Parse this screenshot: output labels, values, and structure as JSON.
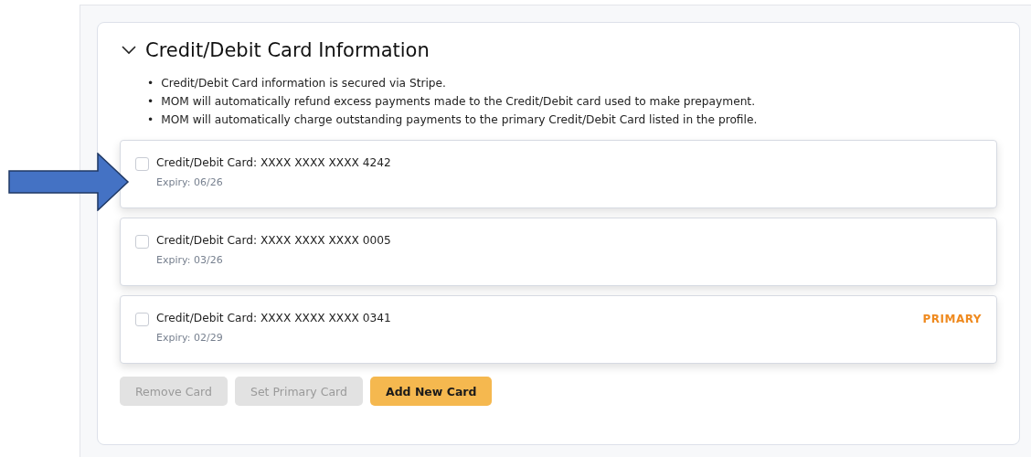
{
  "section": {
    "title": "Credit/Debit Card Information",
    "expanded": true
  },
  "notes": [
    {
      "bullet": "•",
      "text": "Credit/Debit Card information is secured via Stripe."
    },
    {
      "bullet": "•",
      "text": "MOM will automatically refund excess payments made to the Credit/Debit card used to make prepayment."
    },
    {
      "bullet": "•",
      "text": "MOM will automatically charge outstanding payments to the primary Credit/Debit Card listed in the profile."
    }
  ],
  "annotation": {
    "kind": "arrow"
  },
  "cards": [
    {
      "label": "Credit/Debit Card: XXXX XXXX XXXX 4242",
      "expiry": "Expiry: 06/26",
      "checked": false
    },
    {
      "label": "Credit/Debit Card: XXXX XXXX XXXX 0005",
      "expiry": "Expiry: 03/26",
      "checked": false
    },
    {
      "label": "Credit/Debit Card: XXXX XXXX XXXX 0341",
      "expiry": "Expiry: 02/29",
      "checked": false,
      "badge": "PRIMARY"
    }
  ],
  "buttons": [
    {
      "label": "Remove Card",
      "disabled": true,
      "kind": "secondary"
    },
    {
      "label": "Set Primary Card",
      "disabled": true,
      "kind": "secondary"
    },
    {
      "label": "Add New Card",
      "disabled": false,
      "kind": "primary"
    }
  ]
}
